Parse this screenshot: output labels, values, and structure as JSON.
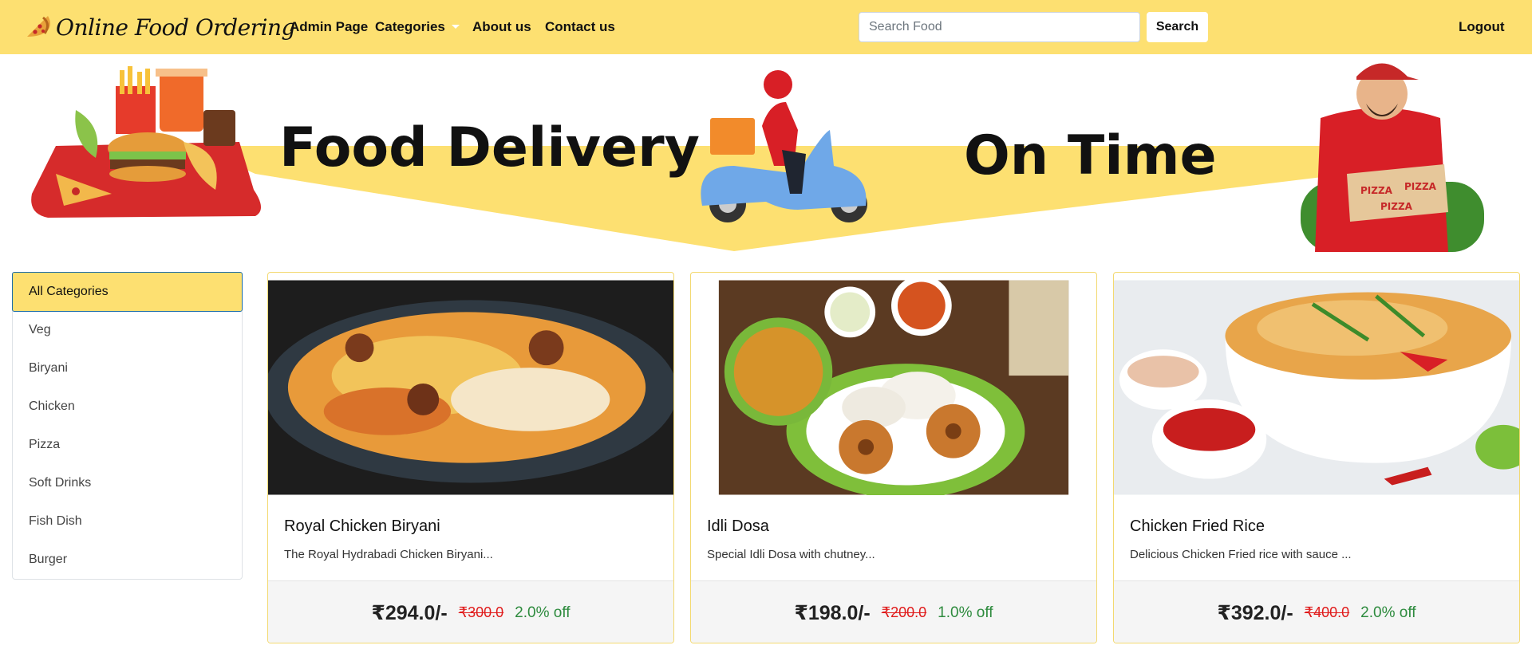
{
  "brand": {
    "title": "Online Food Ordering"
  },
  "nav": {
    "admin": "Admin Page",
    "categories": "Categories",
    "about": "About us",
    "contact": "Contact us",
    "logout": "Logout"
  },
  "search": {
    "placeholder": "Search Food",
    "value": "",
    "button": "Search"
  },
  "banner": {
    "headline_left": "Food Delivery",
    "headline_right": "On Time",
    "box_text": "PIZZA"
  },
  "categories": [
    "All Categories",
    "Veg",
    "Biryani",
    "Chicken",
    "Pizza",
    "Soft Drinks",
    "Fish Dish",
    "Burger"
  ],
  "products": [
    {
      "name": "Royal Chicken Biryani",
      "desc": "The Royal Hydrabadi Chicken Biryani...",
      "price": "₹294.0/-",
      "old_price": "₹300.0",
      "discount": "2.0% off"
    },
    {
      "name": "Idli Dosa",
      "desc": "Special Idli Dosa with chutney...",
      "price": "₹198.0/-",
      "old_price": "₹200.0",
      "discount": "1.0% off"
    },
    {
      "name": "Chicken Fried Rice",
      "desc": "Delicious Chicken Fried rice with sauce ...",
      "price": "₹392.0/-",
      "old_price": "₹400.0",
      "discount": "2.0% off"
    }
  ],
  "colors": {
    "accent": "#fde071",
    "strike": "#e01b1b",
    "discount": "#2e8b3e"
  },
  "icons": {
    "brand": "pizza-slice-icon",
    "dropdown": "caret-down-icon"
  }
}
